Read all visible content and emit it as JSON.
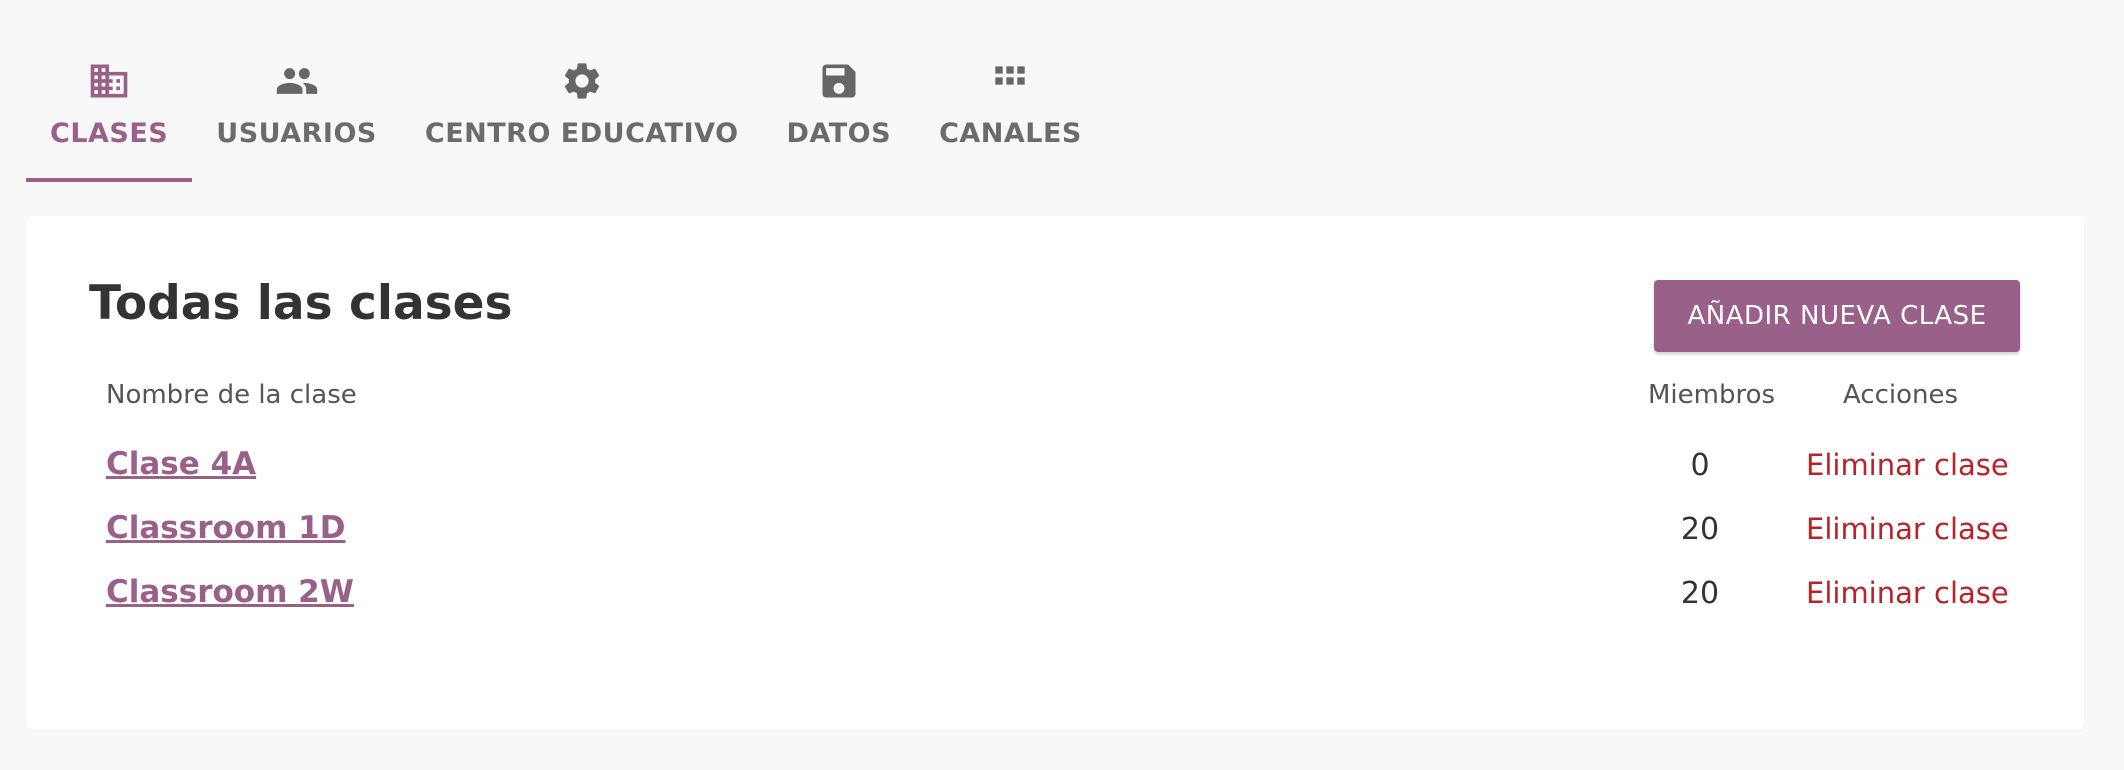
{
  "tabs": [
    {
      "label": "CLASES",
      "icon": "building-icon",
      "active": true
    },
    {
      "label": "USUARIOS",
      "icon": "people-icon",
      "active": false
    },
    {
      "label": "CENTRO EDUCATIVO",
      "icon": "gear-icon",
      "active": false
    },
    {
      "label": "DATOS",
      "icon": "save-icon",
      "active": false
    },
    {
      "label": "CANALES",
      "icon": "apps-grid-icon",
      "active": false
    }
  ],
  "main": {
    "title": "Todas las clases",
    "add_button_label": "AÑADIR NUEVA CLASE",
    "columns": {
      "name": "Nombre de la clase",
      "members": "Miembros",
      "actions": "Acciones"
    },
    "rows": [
      {
        "name": "Clase 4A",
        "members": "0",
        "action": "Eliminar clase"
      },
      {
        "name": "Classroom 1D",
        "members": "20",
        "action": "Eliminar clase"
      },
      {
        "name": "Classroom 2W",
        "members": "20",
        "action": "Eliminar clase"
      }
    ]
  },
  "colors": {
    "accent": "#996189",
    "danger": "#b8232b",
    "background": "#f8f8f8"
  }
}
